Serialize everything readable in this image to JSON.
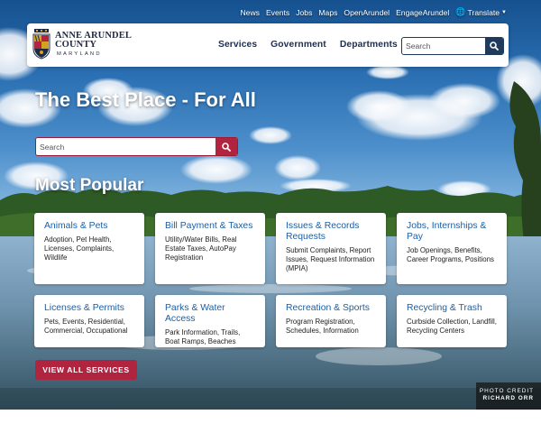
{
  "utility_nav": {
    "items": [
      "News",
      "Events",
      "Jobs",
      "Maps",
      "OpenArundel",
      "EngageArundel"
    ],
    "translate_label": "Translate"
  },
  "logo": {
    "line1": "ANNE ARUNDEL",
    "line2": "COUNTY",
    "line3": "MARYLAND"
  },
  "main_nav": {
    "items": [
      "Services",
      "Government",
      "Departments"
    ]
  },
  "header_search": {
    "placeholder": "Search"
  },
  "hero": {
    "title": "The Best Place - For All",
    "search_placeholder": "Search"
  },
  "popular": {
    "heading": "Most Popular",
    "cards": [
      {
        "title": "Animals & Pets",
        "desc": "Adoption, Pet Health, Licenses, Complaints, Wildlife"
      },
      {
        "title": "Bill Payment & Taxes",
        "desc": "Utility/Water Bills, Real Estate Taxes, AutoPay Registration"
      },
      {
        "title": "Issues & Records Requests",
        "desc": "Submit Complaints, Report Issues, Request Information (MPIA)"
      },
      {
        "title": "Jobs, Internships & Pay",
        "desc": "Job Openings, Benefits, Career Programs, Positions"
      },
      {
        "title": "Licenses & Permits",
        "desc": "Pets, Events, Residential, Commercial, Occupational"
      },
      {
        "title": "Parks & Water Access",
        "desc": "Park Information, Trails, Boat Ramps, Beaches"
      },
      {
        "title": "Recreation & Sports",
        "desc": "Program Registration, Schedules, Information"
      },
      {
        "title": "Recycling & Trash",
        "desc": "Curbside Collection, Landfill, Recycling Centers"
      }
    ],
    "view_all_label": "VIEW ALL SERVICES"
  },
  "photo_credit": {
    "label": "PHOTO CREDIT",
    "name": "RICHARD ORR"
  },
  "colors": {
    "accent_red": "#b0243f",
    "navy": "#1f3a5c",
    "link_blue": "#1a5fa6"
  },
  "icons": {
    "search": "search-icon",
    "globe": "globe-icon",
    "caret": "caret-down-icon",
    "seal": "county-seal-icon"
  }
}
